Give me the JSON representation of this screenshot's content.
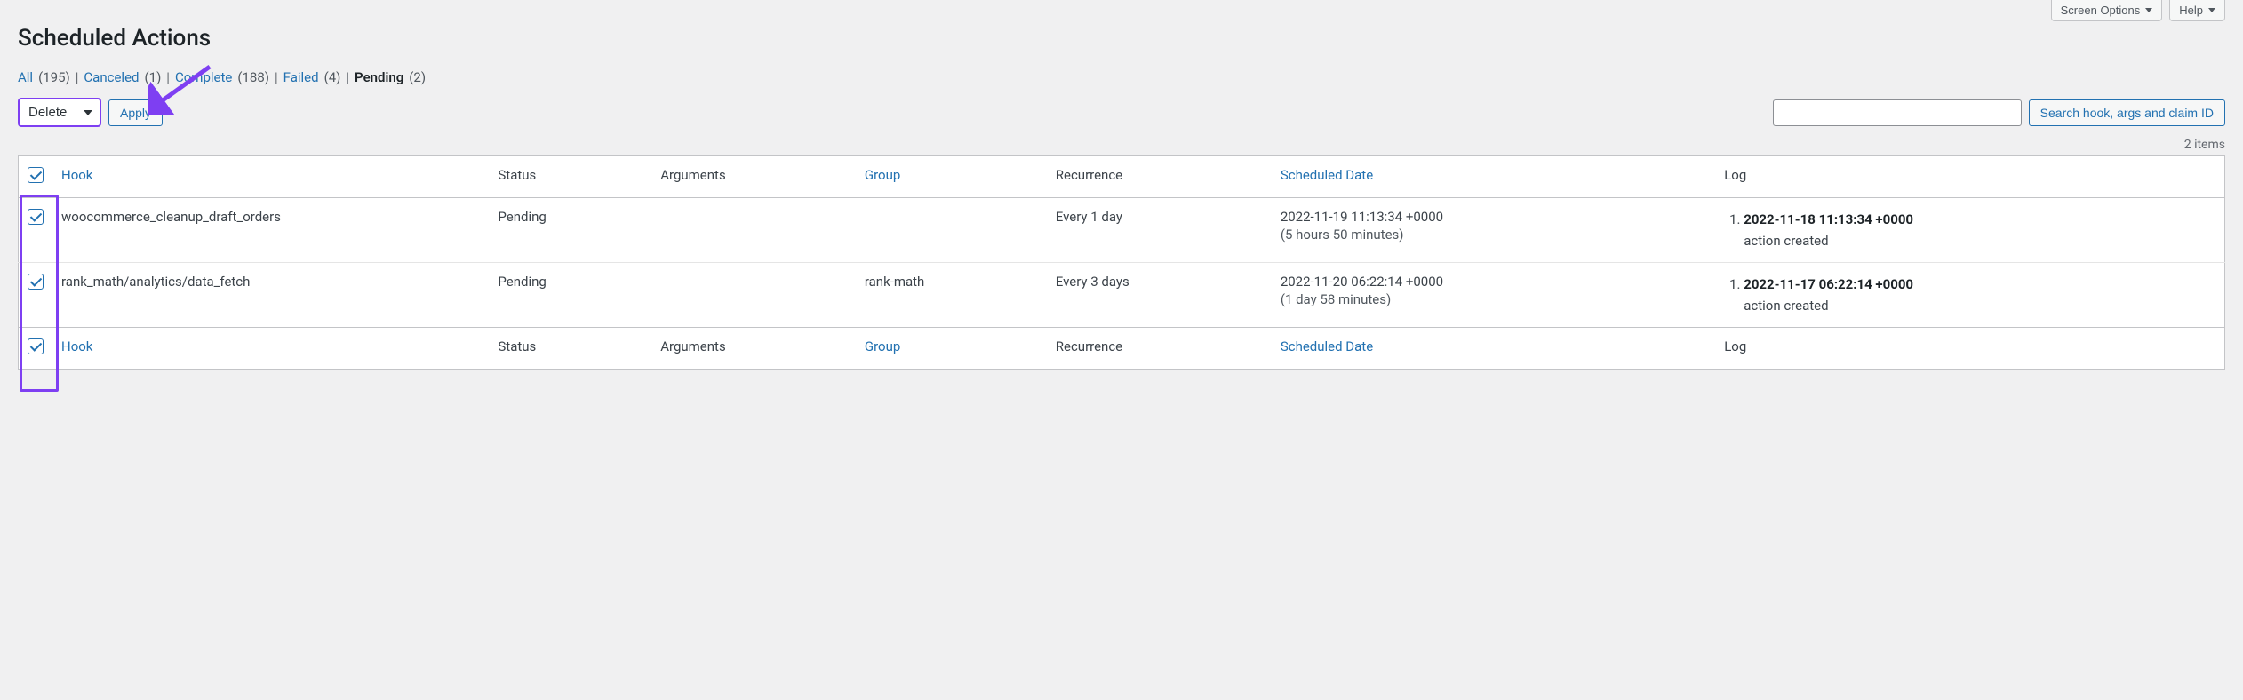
{
  "header": {
    "screen_options": "Screen Options",
    "help": "Help",
    "title": "Scheduled Actions"
  },
  "filters": {
    "all": {
      "label": "All",
      "count": "(195)"
    },
    "canceled": {
      "label": "Canceled",
      "count": "(1)"
    },
    "complete": {
      "label": "Complete",
      "count": "(188)"
    },
    "failed": {
      "label": "Failed",
      "count": "(4)"
    },
    "pending": {
      "label": "Pending",
      "count": "(2)"
    }
  },
  "bulk": {
    "selected": "Delete",
    "apply": "Apply"
  },
  "search": {
    "button": "Search hook, args and claim ID"
  },
  "items_count": "2 items",
  "columns": {
    "hook": "Hook",
    "status": "Status",
    "arguments": "Arguments",
    "group": "Group",
    "recurrence": "Recurrence",
    "scheduled": "Scheduled Date",
    "log": "Log"
  },
  "rows": [
    {
      "hook": "woocommerce_cleanup_draft_orders",
      "status": "Pending",
      "arguments": "",
      "group": "",
      "recurrence": "Every 1 day",
      "scheduled_date": "2022-11-19 11:13:34 +0000",
      "scheduled_rel": "(5 hours 50 minutes)",
      "log_ts": "2022-11-18 11:13:34 +0000",
      "log_msg": "action created"
    },
    {
      "hook": "rank_math/analytics/data_fetch",
      "status": "Pending",
      "arguments": "",
      "group": "rank-math",
      "recurrence": "Every 3 days",
      "scheduled_date": "2022-11-20 06:22:14 +0000",
      "scheduled_rel": "(1 day 58 minutes)",
      "log_ts": "2022-11-17 06:22:14 +0000",
      "log_msg": "action created"
    }
  ]
}
